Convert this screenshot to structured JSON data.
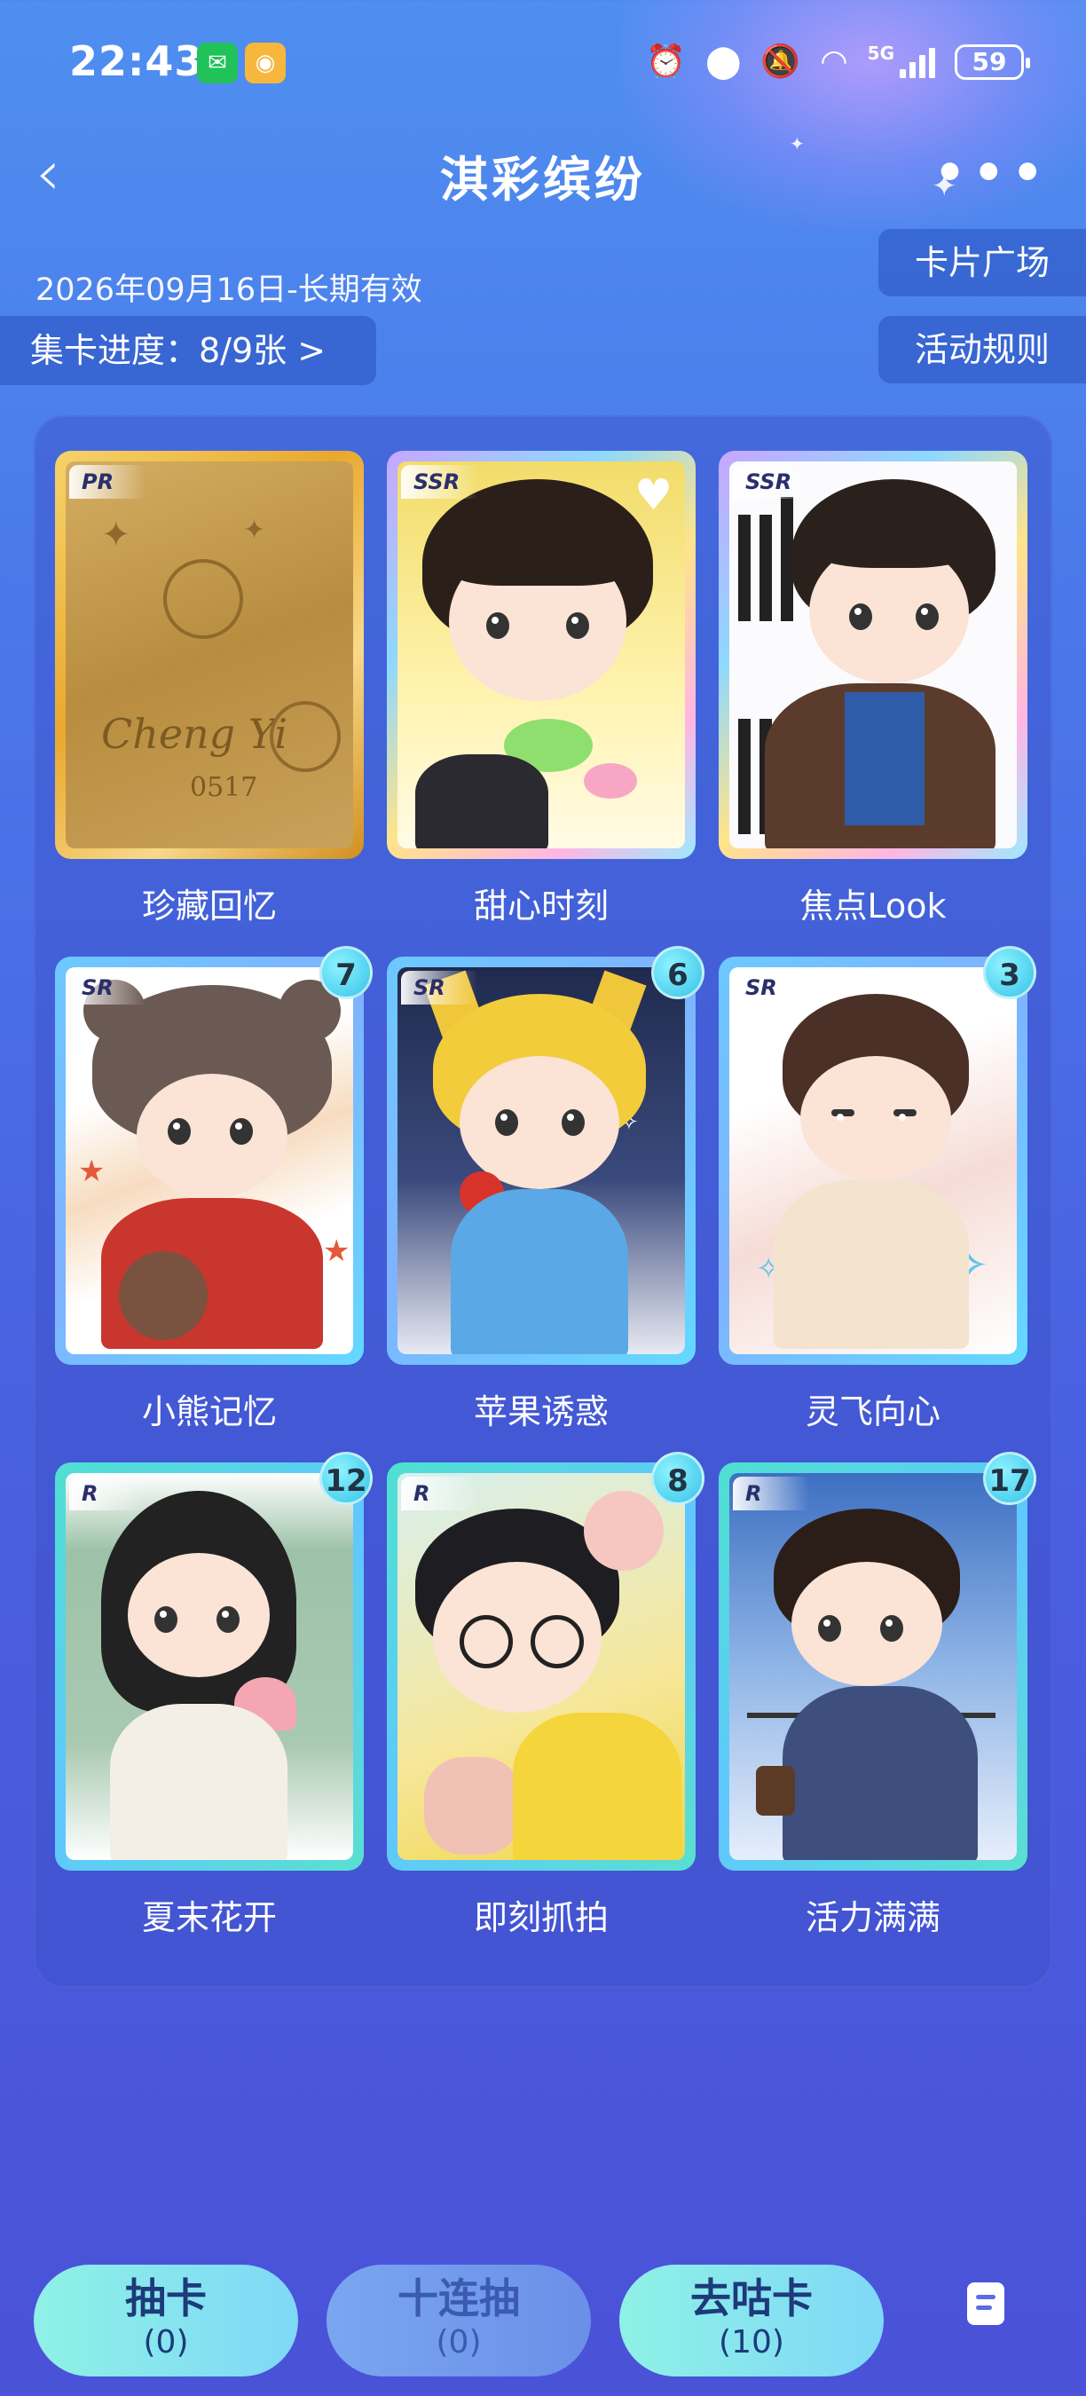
{
  "status_bar": {
    "time": "22:43",
    "network": "5G",
    "battery": "59",
    "icons": [
      "alarm-icon",
      "location-icon",
      "mute-icon",
      "wifi-icon",
      "signal-icon",
      "battery-icon"
    ]
  },
  "header": {
    "title": "淇彩缤纷",
    "back_icon": "‹",
    "more_icon": "•••"
  },
  "info": {
    "validity": "2026年09月16日-长期有效",
    "progress": "集卡进度：8/9张 >",
    "card_square": "卡片广场",
    "activity_rules": "活动规则"
  },
  "cards": [
    {
      "name": "珍藏回忆",
      "rarity": "PR",
      "count": "",
      "frame": "pr"
    },
    {
      "name": "甜心时刻",
      "rarity": "SSR",
      "count": "",
      "frame": "ssr"
    },
    {
      "name": "焦点Look",
      "rarity": "SSR",
      "count": "",
      "frame": "ssr"
    },
    {
      "name": "小熊记忆",
      "rarity": "SR",
      "count": "7",
      "frame": "sr"
    },
    {
      "name": "苹果诱惑",
      "rarity": "SR",
      "count": "6",
      "frame": "sr"
    },
    {
      "name": "灵飞向心",
      "rarity": "SR",
      "count": "3",
      "frame": "sr"
    },
    {
      "name": "夏末花开",
      "rarity": "R",
      "count": "12",
      "frame": "r"
    },
    {
      "name": "即刻抓拍",
      "rarity": "R",
      "count": "8",
      "frame": "r"
    },
    {
      "name": "活力满满",
      "rarity": "R",
      "count": "17",
      "frame": "r"
    }
  ],
  "card0_text": {
    "line1": "Cheng Yi",
    "line2": "0517"
  },
  "bottom": {
    "draw": {
      "label": "抽卡",
      "sub": "(0)"
    },
    "ten": {
      "label": "十连抽",
      "sub": "(0)"
    },
    "go": {
      "label": "去咕卡",
      "sub": "(10)"
    }
  }
}
